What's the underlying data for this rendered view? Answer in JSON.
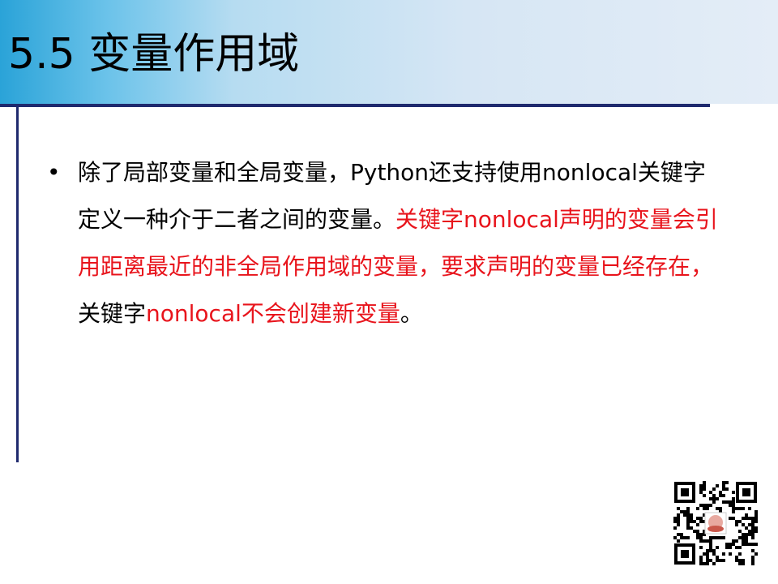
{
  "slide": {
    "title": "5.5 变量作用域",
    "bullet_marker": "•",
    "paragraph": {
      "seg1": "除了局部变量和全局变量，Python还支持使用nonlocal关键字定义一种介于二者之间的变量。",
      "seg2": "关键字nonlocal声明的变量会引用距离最近的非全局作用域的变量，要求声明的变量已经存在，",
      "seg3": "关键字",
      "seg4": "nonlocal不会创建新变量",
      "seg5": "。"
    }
  },
  "colors": {
    "title_gradient_start": "#2aa3d8",
    "title_gradient_end": "#e4edf7",
    "rule": "#1f2a6e",
    "text": "#000000",
    "highlight": "#e8141c"
  },
  "qr_code": {
    "icon": "qr-code-icon"
  }
}
